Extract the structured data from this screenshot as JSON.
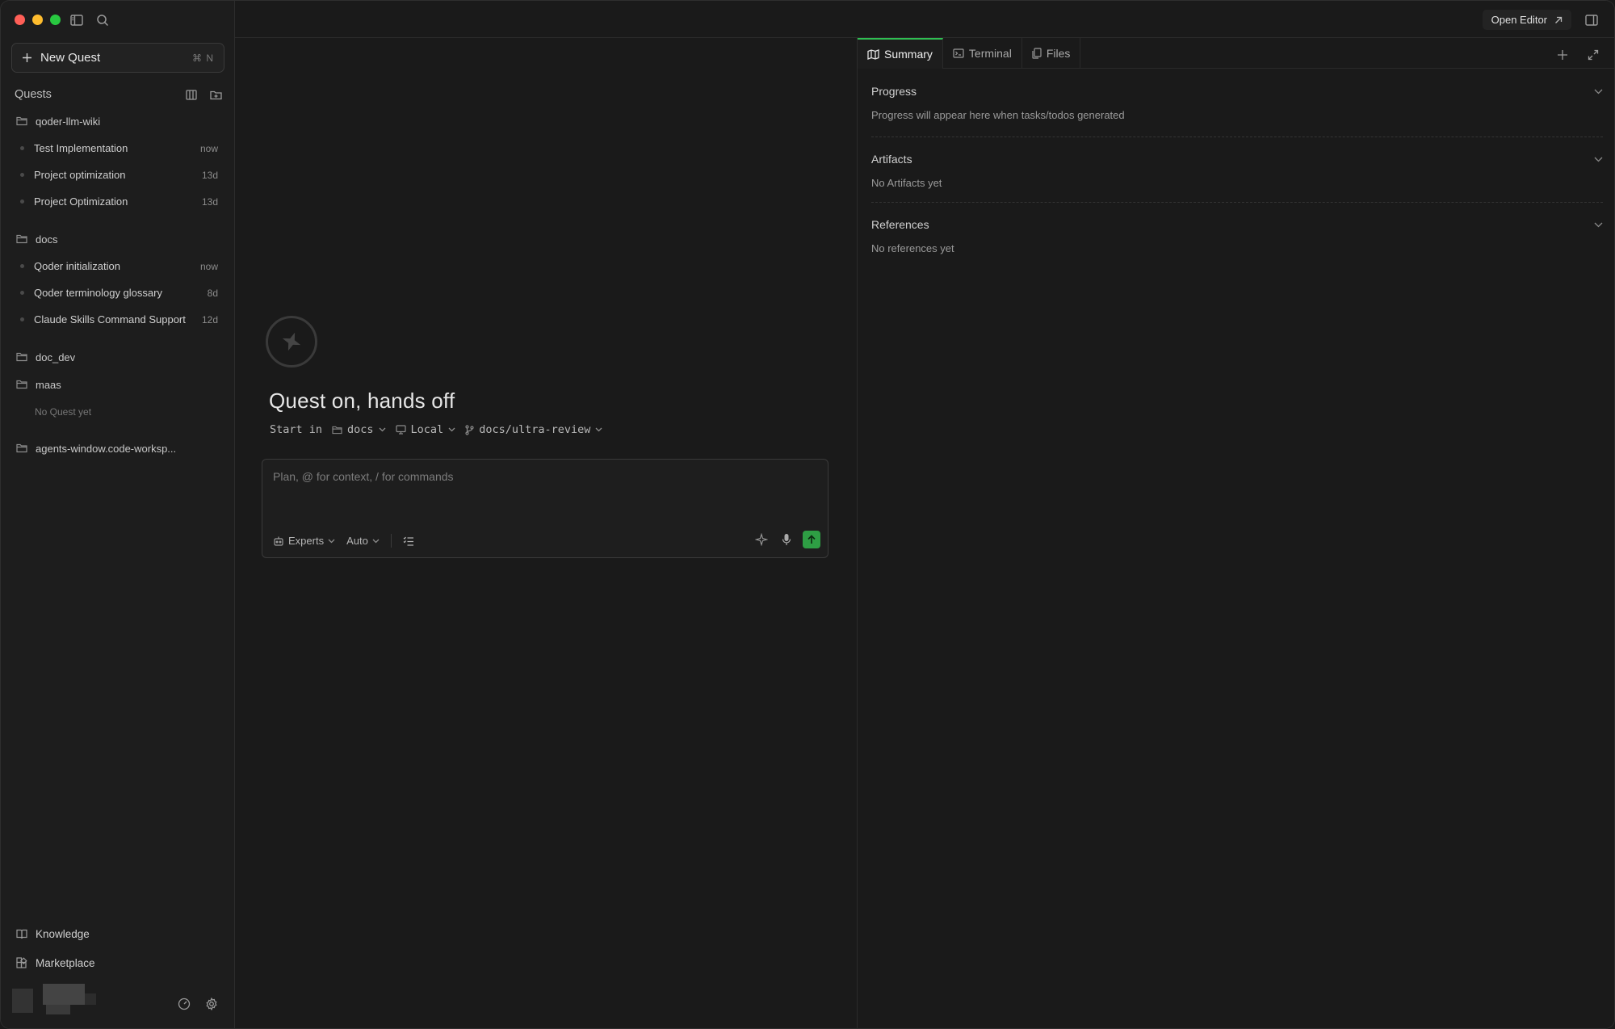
{
  "sidebar": {
    "new_quest_label": "New Quest",
    "new_quest_shortcut": "⌘ N",
    "quests_heading": "Quests",
    "groups": [
      {
        "folder": "qoder-llm-wiki",
        "items": [
          {
            "title": "Test Implementation",
            "time": "now"
          },
          {
            "title": "Project optimization",
            "time": "13d"
          },
          {
            "title": "Project Optimization",
            "time": "13d"
          }
        ]
      },
      {
        "folder": "docs",
        "items": [
          {
            "title": "Qoder initialization",
            "time": "now"
          },
          {
            "title": "Qoder terminology glossary",
            "time": "8d"
          },
          {
            "title": "Claude Skills Command Support",
            "time": "12d"
          }
        ]
      },
      {
        "folder": "doc_dev"
      },
      {
        "folder": "maas",
        "empty_note": "No Quest yet"
      },
      {
        "folder": "agents-window.code-worksp..."
      }
    ],
    "bottom_links": [
      "Knowledge",
      "Marketplace"
    ]
  },
  "topbar": {
    "open_editor_label": "Open Editor"
  },
  "center": {
    "hero_title": "Quest on, hands off",
    "start_in_label": "Start in",
    "start_folder": "docs",
    "start_env": "Local",
    "start_branch": "docs/ultra-review",
    "composer_placeholder": "Plan, @ for context, / for commands",
    "experts_label": "Experts",
    "mode_label": "Auto"
  },
  "right_panel": {
    "tabs": [
      "Summary",
      "Terminal",
      "Files"
    ],
    "active_tab": "Summary",
    "sections": [
      {
        "title": "Progress",
        "body": "Progress will appear here when tasks/todos generated"
      },
      {
        "title": "Artifacts",
        "body": "No Artifacts yet"
      },
      {
        "title": "References",
        "body": "No references yet"
      }
    ]
  },
  "colors": {
    "accent": "#2fbf52",
    "send_button": "#2e9e44",
    "background": "#1a1a1a",
    "sidebar_background": "#1d1d1d"
  },
  "icons": {
    "window_controls": [
      "close",
      "minimize",
      "zoom"
    ],
    "top": [
      "sidebar-toggle-icon",
      "search-icon"
    ],
    "quests_header": [
      "columns-icon",
      "new-folder-icon"
    ],
    "composer": [
      "sparkle-icon",
      "microphone-icon",
      "arrow-up-icon"
    ]
  }
}
